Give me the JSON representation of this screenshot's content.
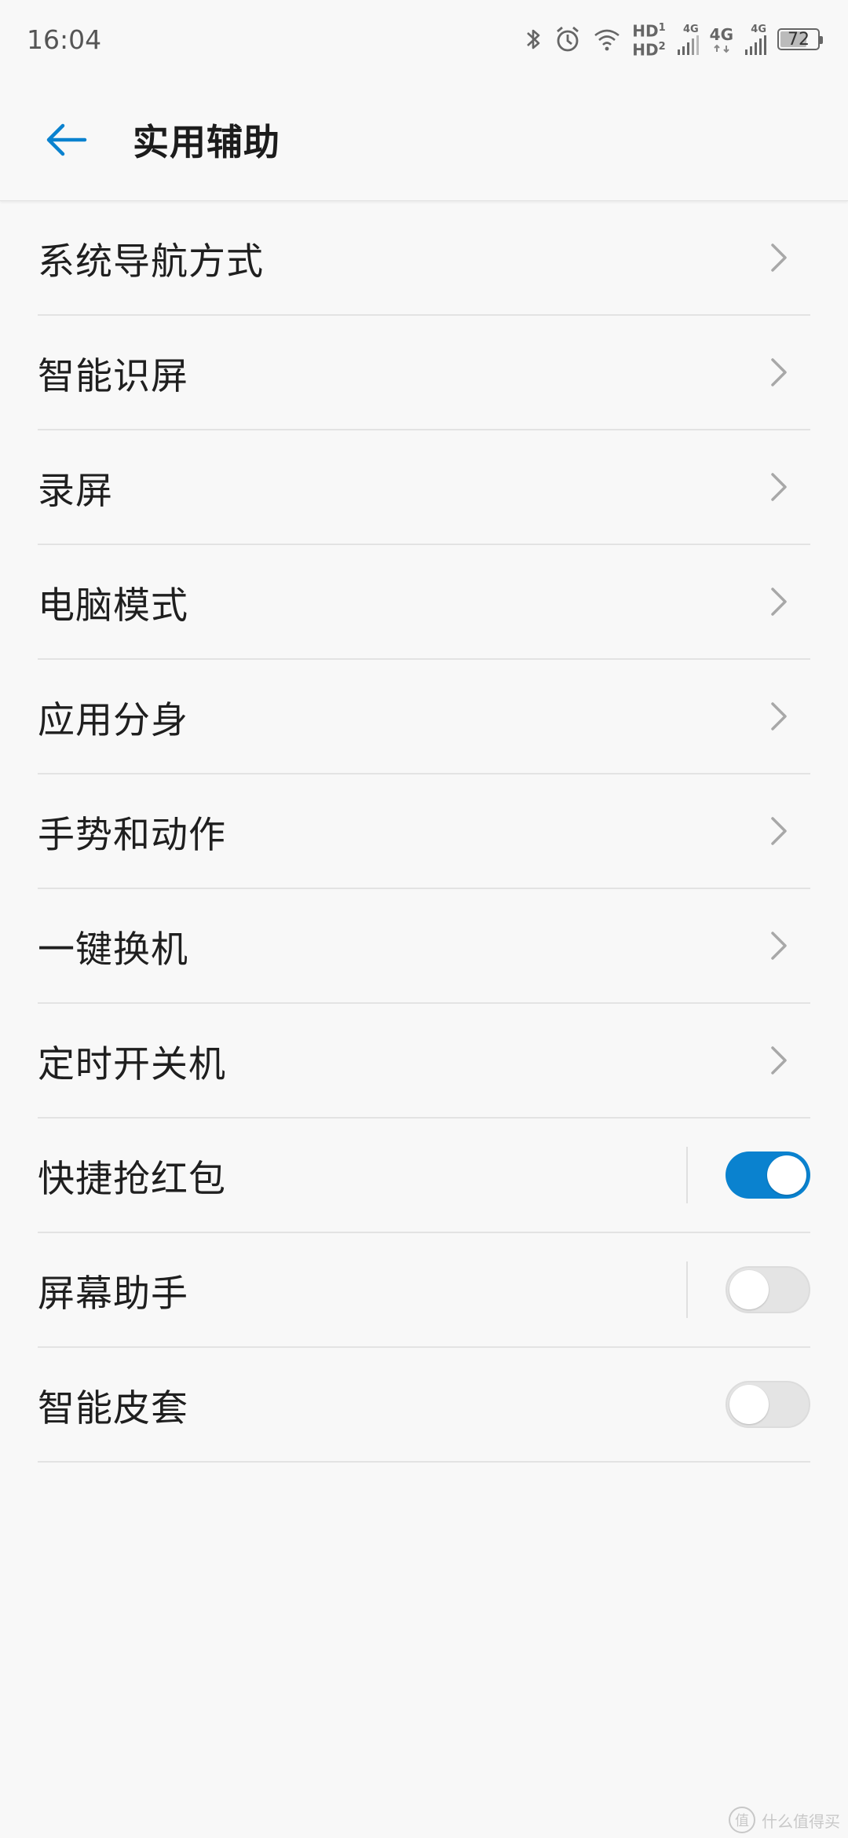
{
  "status_bar": {
    "time": "16:04",
    "hd_top": "HD",
    "hd_bottom": "HD",
    "sup_1": "1",
    "sup_2": "2",
    "net_small_1": "4G",
    "net_4g": "4G",
    "net_small_2": "4G",
    "battery_level": "72",
    "battery_fraction": 0.72,
    "icons": [
      "bluetooth-icon",
      "alarm-icon",
      "wifi-icon",
      "signal-icon",
      "battery-icon"
    ]
  },
  "header": {
    "back_icon": "arrow-left-icon",
    "title": "实用辅助",
    "accent_color": "#0a82cf"
  },
  "settings": [
    {
      "label": "系统导航方式",
      "control": "chevron"
    },
    {
      "label": "智能识屏",
      "control": "chevron"
    },
    {
      "label": "录屏",
      "control": "chevron"
    },
    {
      "label": "电脑模式",
      "control": "chevron"
    },
    {
      "label": "应用分身",
      "control": "chevron"
    },
    {
      "label": "手势和动作",
      "control": "chevron"
    },
    {
      "label": "一键换机",
      "control": "chevron"
    },
    {
      "label": "定时开关机",
      "control": "chevron"
    },
    {
      "label": "快捷抢红包",
      "control": "switch",
      "state": "on"
    },
    {
      "label": "屏幕助手",
      "control": "switch",
      "state": "off"
    },
    {
      "label": "智能皮套",
      "control": "switch",
      "state": "off"
    }
  ],
  "watermark": {
    "badge": "值",
    "text": "什么值得买"
  }
}
